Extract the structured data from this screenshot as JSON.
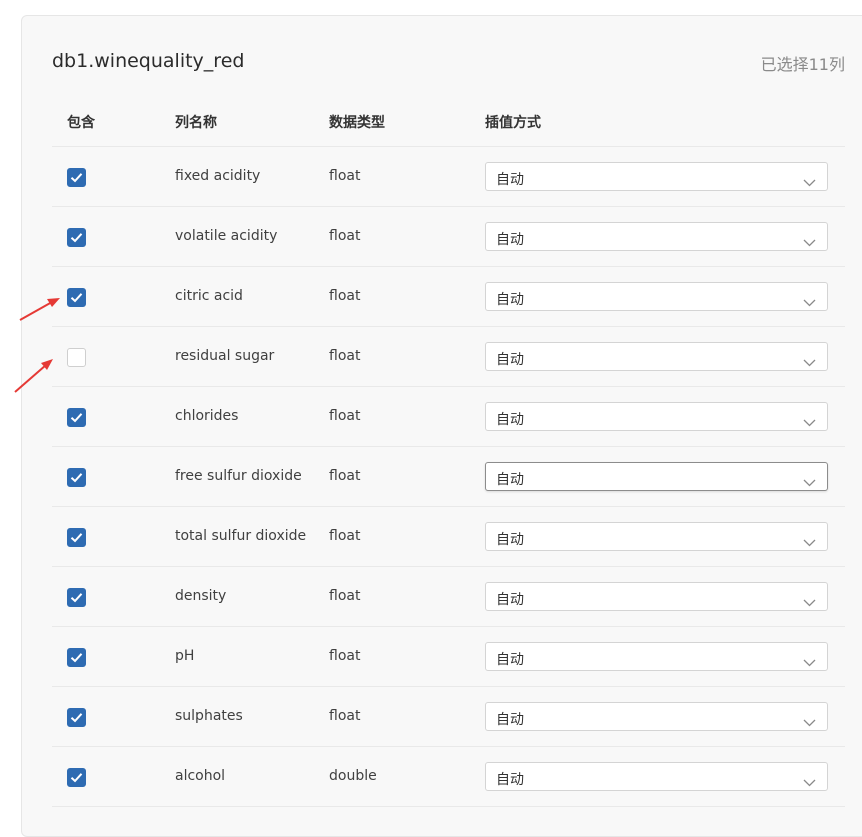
{
  "panel": {
    "table_name": "db1.winequality_red",
    "selected_count_text": "已选择11列"
  },
  "columns_header": {
    "include": "包含",
    "column_name": "列名称",
    "data_type": "数据类型",
    "impute_method": "插值方式"
  },
  "rows": [
    {
      "checked": true,
      "name": "fixed acidity",
      "type": "float",
      "impute": "自动"
    },
    {
      "checked": true,
      "name": "volatile acidity",
      "type": "float",
      "impute": "自动"
    },
    {
      "checked": true,
      "name": "citric acid",
      "type": "float",
      "impute": "自动"
    },
    {
      "checked": false,
      "name": "residual sugar",
      "type": "float",
      "impute": "自动"
    },
    {
      "checked": true,
      "name": "chlorides",
      "type": "float",
      "impute": "自动"
    },
    {
      "checked": true,
      "name": "free sulfur dioxide",
      "type": "float",
      "impute": "自动"
    },
    {
      "checked": true,
      "name": "total sulfur dioxide",
      "type": "float",
      "impute": "自动"
    },
    {
      "checked": true,
      "name": "density",
      "type": "float",
      "impute": "自动"
    },
    {
      "checked": true,
      "name": "pH",
      "type": "float",
      "impute": "自动"
    },
    {
      "checked": true,
      "name": "sulphates",
      "type": "float",
      "impute": "自动"
    },
    {
      "checked": true,
      "name": "alcohol",
      "type": "double",
      "impute": "自动"
    }
  ],
  "colors": {
    "checkbox_checked": "#2e6bb2",
    "annotation_arrow": "#e53935"
  },
  "icons": {
    "checkbox": "checkmark-icon",
    "dropdown": "chevron-down-icon",
    "annotation": "red-arrow-icon"
  }
}
